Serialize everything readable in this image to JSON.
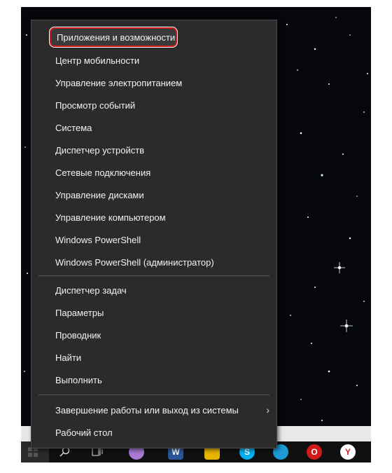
{
  "menu": {
    "items": [
      {
        "label": "Приложения и возможности",
        "highlighted": true
      },
      {
        "label": "Центр мобильности"
      },
      {
        "label": "Управление электропитанием"
      },
      {
        "label": "Просмотр событий"
      },
      {
        "label": "Система"
      },
      {
        "label": "Диспетчер устройств"
      },
      {
        "label": "Сетевые подключения"
      },
      {
        "label": "Управление дисками"
      },
      {
        "label": "Управление компьютером"
      },
      {
        "label": "Windows PowerShell"
      },
      {
        "label": "Windows PowerShell (администратор)"
      },
      {
        "label": "Диспетчер задач"
      },
      {
        "label": "Параметры"
      },
      {
        "label": "Проводник"
      },
      {
        "label": "Найти"
      },
      {
        "label": "Выполнить"
      },
      {
        "label": "Завершение работы или выход из системы",
        "submenu": true
      },
      {
        "label": "Рабочий стол"
      }
    ],
    "submenu_chevron": "›",
    "highlight_color": "#d11a1a"
  },
  "taskbar": {
    "icons": [
      {
        "name": "windows-start-icon"
      },
      {
        "name": "search-icon"
      },
      {
        "name": "task-view-icon"
      },
      {
        "name": "cortana-icon",
        "color": "#a77bd6"
      },
      {
        "name": "word-icon",
        "glyph": "W",
        "color": "#2b579a"
      },
      {
        "name": "file-explorer-icon",
        "color": "#e8b400"
      },
      {
        "name": "skype-icon",
        "glyph": "S",
        "color": "#00aff0"
      },
      {
        "name": "edge-icon",
        "color": "#1e9bd7"
      },
      {
        "name": "opera-icon",
        "glyph": "O",
        "color": "#d11a1a"
      },
      {
        "name": "yandex-browser-icon",
        "glyph": "Y",
        "color": "#ffffff"
      }
    ]
  }
}
